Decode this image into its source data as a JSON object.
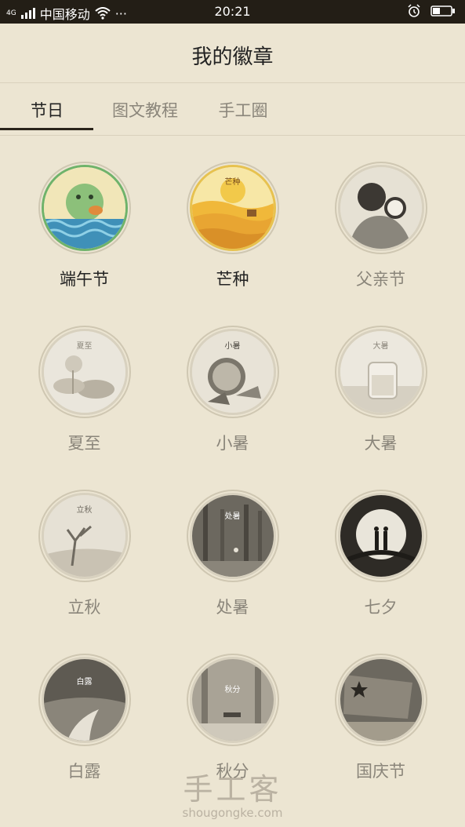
{
  "status_bar": {
    "network": "4G",
    "carrier": "中国移动",
    "more": "···",
    "time": "20:21"
  },
  "header": {
    "title": "我的徽章"
  },
  "tabs": [
    {
      "label": "节日",
      "active": true
    },
    {
      "label": "图文教程"
    },
    {
      "label": "手工圈"
    }
  ],
  "badges": [
    {
      "name": "端午节",
      "earned": true,
      "icon": "dragon-boat-badge-icon"
    },
    {
      "name": "芒种",
      "earned": true,
      "icon": "grain-in-ear-badge-icon",
      "inner_text": "芒种"
    },
    {
      "name": "父亲节",
      "earned": false,
      "icon": "fathers-day-badge-icon"
    },
    {
      "name": "夏至",
      "earned": false,
      "icon": "summer-solstice-badge-icon",
      "inner_text": "夏至"
    },
    {
      "name": "小暑",
      "earned": false,
      "icon": "minor-heat-badge-icon",
      "inner_text": "小暑"
    },
    {
      "name": "大暑",
      "earned": false,
      "icon": "major-heat-badge-icon",
      "inner_text": "大暑"
    },
    {
      "name": "立秋",
      "earned": false,
      "icon": "start-of-autumn-badge-icon",
      "inner_text": "立秋"
    },
    {
      "name": "处暑",
      "earned": false,
      "icon": "end-of-heat-badge-icon",
      "inner_text": "处暑"
    },
    {
      "name": "七夕",
      "earned": false,
      "icon": "qixi-badge-icon"
    },
    {
      "name": "白露",
      "earned": false,
      "icon": "white-dew-badge-icon",
      "inner_text": "白露"
    },
    {
      "name": "秋分",
      "earned": false,
      "icon": "autumn-equinox-badge-icon",
      "inner_text": "秋分"
    },
    {
      "name": "国庆节",
      "earned": false,
      "icon": "national-day-badge-icon"
    }
  ],
  "watermark": {
    "title": "手工客",
    "url": "shougongke.com"
  },
  "colors": {
    "background": "#ece5d2",
    "status_bar": "#231e16",
    "text_active": "#222222",
    "text_inactive": "#8a857a"
  }
}
